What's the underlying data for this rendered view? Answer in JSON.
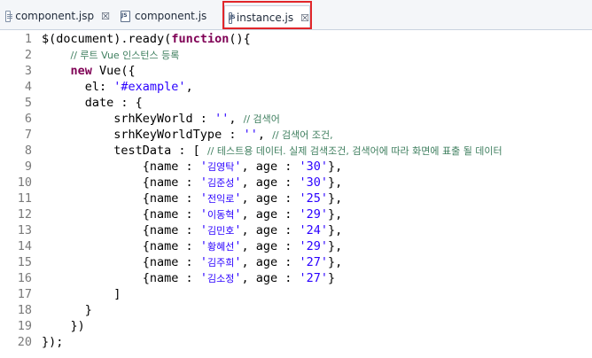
{
  "tabs": [
    {
      "label": "component.jsp",
      "icon": "jsp-file-icon",
      "close": "☒",
      "active": false
    },
    {
      "label": "component.js",
      "icon": "js-file-icon",
      "close": "",
      "active": false
    },
    {
      "label": "instance.js",
      "icon": "js-file-icon",
      "close": "☒",
      "active": true
    }
  ],
  "colors": {
    "keyword": "#7f0055",
    "string": "#2a00ff",
    "comment": "#3f7f5f",
    "highlight": "#e1262a"
  },
  "lines": [
    {
      "n": "1",
      "s": [
        [
          "",
          "$(document).ready("
        ],
        [
          "kw",
          "function"
        ],
        [
          "",
          "(){"
        ]
      ]
    },
    {
      "n": "2",
      "s": [
        [
          "",
          "    "
        ],
        [
          "cmt",
          "// 루트 Vue 인스턴스 등록"
        ]
      ]
    },
    {
      "n": "3",
      "s": [
        [
          "",
          "    "
        ],
        [
          "kw",
          "new"
        ],
        [
          "",
          " Vue({"
        ]
      ]
    },
    {
      "n": "4",
      "s": [
        [
          "",
          "      el: "
        ],
        [
          "str",
          "'#example'"
        ],
        [
          "",
          ","
        ]
      ]
    },
    {
      "n": "5",
      "s": [
        [
          "",
          "      date : {"
        ]
      ]
    },
    {
      "n": "6",
      "s": [
        [
          "",
          "          srhKeyWorld : "
        ],
        [
          "str",
          "''"
        ],
        [
          "",
          ", "
        ],
        [
          "cmt",
          "// 검색어"
        ]
      ]
    },
    {
      "n": "7",
      "s": [
        [
          "",
          "          srhKeyWorldType : "
        ],
        [
          "str",
          "''"
        ],
        [
          "",
          ", "
        ],
        [
          "cmt",
          "// 검색어 조건,"
        ]
      ]
    },
    {
      "n": "8",
      "s": [
        [
          "",
          "          testData : [ "
        ],
        [
          "cmt",
          "// 테스트용 데이터. 실제 검색조건, 검색어에 따라 화면에 표출 될 데이터"
        ]
      ]
    },
    {
      "n": "9",
      "s": [
        [
          "",
          "              {name : "
        ],
        [
          "str",
          "'"
        ],
        [
          "ko",
          "김영탁"
        ],
        [
          "str",
          "'"
        ],
        [
          "",
          ", age : "
        ],
        [
          "str",
          "'30'"
        ],
        [
          "",
          "},"
        ]
      ]
    },
    {
      "n": "10",
      "s": [
        [
          "",
          "              {name : "
        ],
        [
          "str",
          "'"
        ],
        [
          "ko",
          "김준성"
        ],
        [
          "str",
          "'"
        ],
        [
          "",
          ", age : "
        ],
        [
          "str",
          "'30'"
        ],
        [
          "",
          "},"
        ]
      ]
    },
    {
      "n": "11",
      "s": [
        [
          "",
          "              {name : "
        ],
        [
          "str",
          "'"
        ],
        [
          "ko",
          "전익로"
        ],
        [
          "str",
          "'"
        ],
        [
          "",
          ", age : "
        ],
        [
          "str",
          "'25'"
        ],
        [
          "",
          "},"
        ]
      ]
    },
    {
      "n": "12",
      "s": [
        [
          "",
          "              {name : "
        ],
        [
          "str",
          "'"
        ],
        [
          "ko",
          "이동혁"
        ],
        [
          "str",
          "'"
        ],
        [
          "",
          ", age : "
        ],
        [
          "str",
          "'29'"
        ],
        [
          "",
          "},"
        ]
      ]
    },
    {
      "n": "13",
      "s": [
        [
          "",
          "              {name : "
        ],
        [
          "str",
          "'"
        ],
        [
          "ko",
          "김민호"
        ],
        [
          "str",
          "'"
        ],
        [
          "",
          ", age : "
        ],
        [
          "str",
          "'24'"
        ],
        [
          "",
          "},"
        ]
      ]
    },
    {
      "n": "14",
      "s": [
        [
          "",
          "              {name : "
        ],
        [
          "str",
          "'"
        ],
        [
          "ko",
          "황혜선"
        ],
        [
          "str",
          "'"
        ],
        [
          "",
          ", age : "
        ],
        [
          "str",
          "'29'"
        ],
        [
          "",
          "},"
        ]
      ]
    },
    {
      "n": "15",
      "s": [
        [
          "",
          "              {name : "
        ],
        [
          "str",
          "'"
        ],
        [
          "ko",
          "김주희"
        ],
        [
          "str",
          "'"
        ],
        [
          "",
          ", age : "
        ],
        [
          "str",
          "'27'"
        ],
        [
          "",
          "},"
        ]
      ]
    },
    {
      "n": "16",
      "s": [
        [
          "",
          "              {name : "
        ],
        [
          "str",
          "'"
        ],
        [
          "ko",
          "김소정"
        ],
        [
          "str",
          "'"
        ],
        [
          "",
          ", age : "
        ],
        [
          "str",
          "'27'"
        ],
        [
          "",
          "}"
        ]
      ]
    },
    {
      "n": "17",
      "s": [
        [
          "",
          "          ]"
        ]
      ]
    },
    {
      "n": "18",
      "s": [
        [
          "",
          "      }"
        ]
      ]
    },
    {
      "n": "19",
      "s": [
        [
          "",
          "    })"
        ]
      ]
    },
    {
      "n": "20",
      "s": [
        [
          "",
          "});"
        ]
      ]
    }
  ]
}
